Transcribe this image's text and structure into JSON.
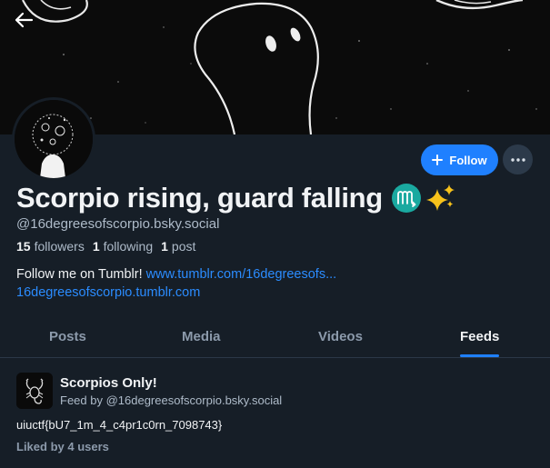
{
  "header": {
    "back_icon": "arrow-left-icon"
  },
  "profile": {
    "display_name": "Scorpio rising, guard falling",
    "emoji": [
      "scorpio-sign-icon",
      "sparkles-icon"
    ],
    "handle": "@16degreesofscorpio.bsky.social",
    "stats": {
      "followers_count": "15",
      "followers_label": "followers",
      "following_count": "1",
      "following_label": "following",
      "posts_count": "1",
      "posts_label": "post"
    },
    "bio": {
      "text": "Follow me on Tumblr!",
      "link1": "www.tumblr.com/16degreesofs...",
      "link2": "16degreesofscorpio.tumblr.com"
    }
  },
  "actions": {
    "follow_label": "Follow",
    "follow_icon": "plus-icon",
    "more_icon": "ellipsis-icon"
  },
  "tabs": [
    {
      "label": "Posts",
      "active": false
    },
    {
      "label": "Media",
      "active": false
    },
    {
      "label": "Videos",
      "active": false
    },
    {
      "label": "Feeds",
      "active": true
    }
  ],
  "feed": {
    "title": "Scorpios Only!",
    "by": "Feed by @16degreesofscorpio.bsky.social",
    "description": "uiuctf{bU7_1m_4_c4pr1c0rn_7098743}",
    "likes": "Liked by 4 users"
  },
  "colors": {
    "accent": "#1f80ff",
    "background": "#161e27",
    "muted_text": "#aebbc9",
    "link": "#2b8cff"
  }
}
